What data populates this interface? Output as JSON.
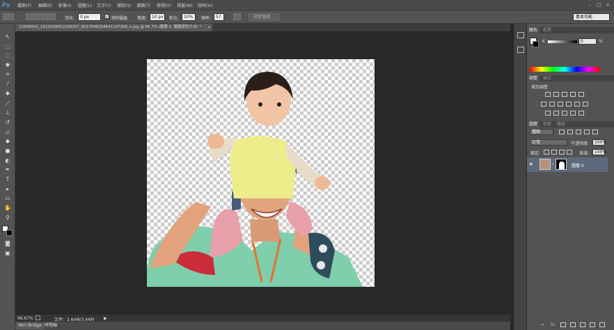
{
  "app": {
    "logo": "Ps"
  },
  "menu": [
    "檔案(F)",
    "編輯(E)",
    "影像(I)",
    "圖層(L)",
    "文字(Y)",
    "選取(S)",
    "濾鏡(T)",
    "檢視(V)",
    "視窗(W)",
    "說明(H)"
  ],
  "window_controls": {
    "minimize": "–",
    "maximize": "□",
    "close": "×"
  },
  "options": {
    "feather_label": "羽化:",
    "feather_value": "0 px",
    "antialias_label": "消除鋸齒",
    "antialias_check": "✓",
    "width_label": "寬度:",
    "width_value": "10 px",
    "contrast_label": "對比:",
    "contrast_value": "10%",
    "frequency_label": "頻率:",
    "frequency_value": "57",
    "refine_edge": "調整邊緣...",
    "workspace": "基本功能"
  },
  "document": {
    "tab_title": "12936641_1023539051028257_9017046154641197358_n.jpg @ 66.7% (圖層 0, 圖層遮色片/8) *",
    "tab_close": "×"
  },
  "status": {
    "zoom": "66.67%",
    "doc_info": "文件：2.64M/3.44M",
    "arrow": "▶"
  },
  "bottom_tabs": [
    "Mini Bridge",
    "時間軸"
  ],
  "panels": {
    "color": {
      "tabs": [
        "顏色",
        "色票"
      ],
      "channel_label": "K",
      "channel_value": "0",
      "percent": "%"
    },
    "adjustments": {
      "tabs": [
        "調整",
        "樣式"
      ],
      "heading": "增加調整"
    },
    "layers": {
      "tabs": [
        "圖層",
        "色版",
        "路徑"
      ],
      "filter_kind": "種類",
      "blend_mode": "正常",
      "opacity_label": "不透明度:",
      "opacity_value": "100%",
      "lock_label": "鎖定:",
      "fill_label": "填滿:",
      "fill_value": "100%",
      "layer_name": "圖層 0"
    }
  },
  "colors": {
    "accent": "#4aa3f0",
    "selected_layer": "#5d6a7d"
  }
}
